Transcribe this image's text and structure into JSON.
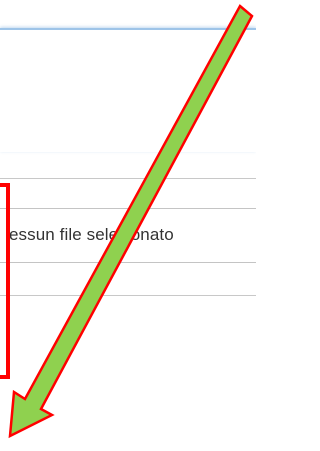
{
  "file_input": {
    "status_text": "essun file selezionato"
  },
  "annotation": {
    "arrow_fill": "#8fd14f",
    "arrow_stroke": "#ff0000",
    "box_color": "#ff0000"
  }
}
